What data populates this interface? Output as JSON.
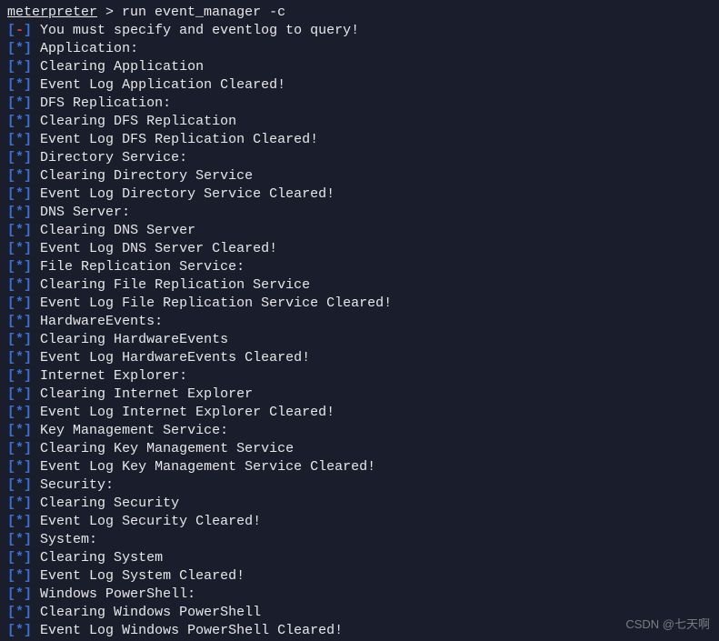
{
  "prompt": {
    "label": "meterpreter",
    "separator": " > ",
    "command": "run event_manager -c"
  },
  "error": {
    "prefix_open": "[",
    "prefix_sym": "-",
    "prefix_close": "]",
    "text": " You must specify and eventlog to query!"
  },
  "info_prefix": {
    "open": "[",
    "sym": "*",
    "close": "]"
  },
  "lines": [
    " Application:",
    " Clearing Application",
    " Event Log Application Cleared!",
    " DFS Replication:",
    " Clearing DFS Replication",
    " Event Log DFS Replication Cleared!",
    " Directory Service:",
    " Clearing Directory Service",
    " Event Log Directory Service Cleared!",
    " DNS Server:",
    " Clearing DNS Server",
    " Event Log DNS Server Cleared!",
    " File Replication Service:",
    " Clearing File Replication Service",
    " Event Log File Replication Service Cleared!",
    " HardwareEvents:",
    " Clearing HardwareEvents",
    " Event Log HardwareEvents Cleared!",
    " Internet Explorer:",
    " Clearing Internet Explorer",
    " Event Log Internet Explorer Cleared!",
    " Key Management Service:",
    " Clearing Key Management Service",
    " Event Log Key Management Service Cleared!",
    " Security:",
    " Clearing Security",
    " Event Log Security Cleared!",
    " System:",
    " Clearing System",
    " Event Log System Cleared!",
    " Windows PowerShell:",
    " Clearing Windows PowerShell",
    " Event Log Windows PowerShell Cleared!"
  ],
  "watermark": "CSDN @七天啊"
}
